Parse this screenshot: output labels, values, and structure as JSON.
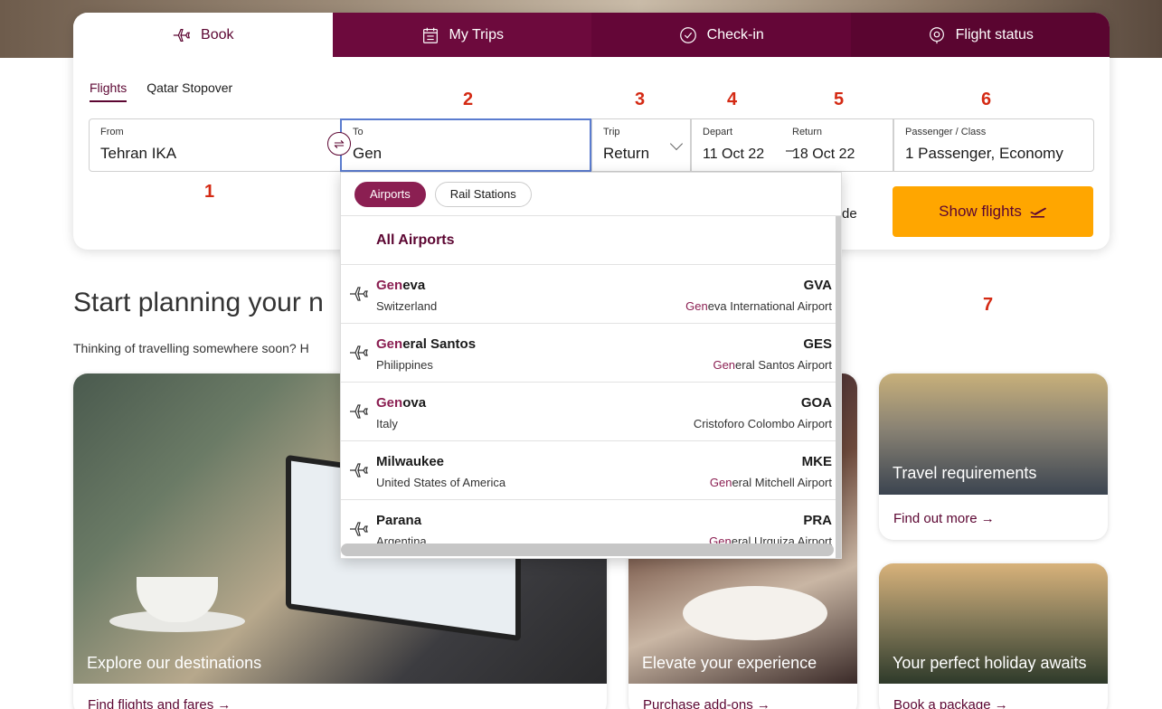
{
  "tabs": [
    {
      "label": "Book",
      "icon": "plane-icon"
    },
    {
      "label": "My Trips",
      "icon": "calendar-icon"
    },
    {
      "label": "Check-in",
      "icon": "check-circle-icon"
    },
    {
      "label": "Flight status",
      "icon": "location-pin-icon"
    }
  ],
  "subtabs": [
    "Flights",
    "Qatar Stopover"
  ],
  "form": {
    "from": {
      "label": "From",
      "value": "Tehran IKA"
    },
    "to": {
      "label": "To",
      "value": "Gen"
    },
    "trip": {
      "label": "Trip",
      "value": "Return"
    },
    "depart": {
      "label": "Depart",
      "value": "11 Oct 22"
    },
    "return": {
      "label": "Return",
      "value": "18 Oct 22"
    },
    "passenger": {
      "label": "Passenger / Class",
      "value": "1 Passenger, Economy"
    },
    "date_separator": "–",
    "promo_partial": "de",
    "show_flights": "Show flights"
  },
  "step_numbers": [
    "1",
    "2",
    "3",
    "4",
    "5",
    "6",
    "7"
  ],
  "section": {
    "title": "Start planning your n",
    "subtitle": "Thinking of travelling somewhere soon? H"
  },
  "dropdown": {
    "filters": [
      "Airports",
      "Rail Stations"
    ],
    "all_label": "All Airports",
    "results": [
      {
        "city_hl": "Gen",
        "city_rest": "eva",
        "country": "Switzerland",
        "code": "GVA",
        "airport_hl": "Gen",
        "airport_rest": "eva International Airport"
      },
      {
        "city_hl": "Gen",
        "city_rest": "eral Santos",
        "country": "Philippines",
        "code": "GES",
        "airport_hl": "Gen",
        "airport_rest": "eral Santos Airport"
      },
      {
        "city_hl": "Gen",
        "city_rest": "ova",
        "country": "Italy",
        "code": "GOA",
        "airport_hl": "",
        "airport_rest": "Cristoforo Colombo Airport"
      },
      {
        "city_hl": "",
        "city_rest": "Milwaukee",
        "country": "United States of America",
        "code": "MKE",
        "airport_hl": "Gen",
        "airport_rest": "eral Mitchell Airport"
      },
      {
        "city_hl": "",
        "city_rest": "Parana",
        "country": "Argentina",
        "code": "PRA",
        "airport_hl": "Gen",
        "airport_rest": "eral Urquiza Airport"
      }
    ]
  },
  "cards": {
    "explore": {
      "caption": "Explore our destinations",
      "link": "Find flights and fares →"
    },
    "elevate": {
      "caption": "Elevate your experience",
      "link": "Purchase add-ons →"
    },
    "travel": {
      "caption": "Travel requirements",
      "link": "Find out more →"
    },
    "holiday": {
      "caption": "Your perfect holiday awaits",
      "link": "Book a package →"
    }
  },
  "colors": {
    "brand": "#5c0632",
    "accent": "#ffa600",
    "highlight": "#8b1f52",
    "step_number": "#d42a14"
  }
}
